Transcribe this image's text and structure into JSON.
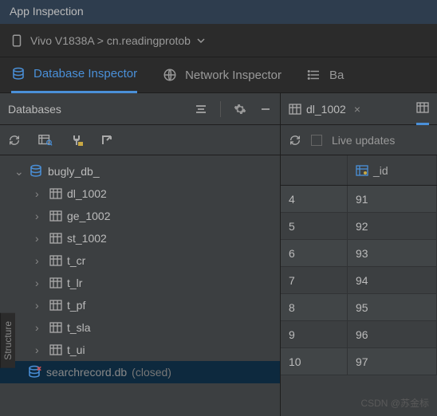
{
  "title": "App Inspection",
  "breadcrumb": "Vivo V1838A > cn.readingprotob",
  "tabs": {
    "database": "Database Inspector",
    "network": "Network Inspector",
    "background": "Ba"
  },
  "left_panel": {
    "title": "Databases"
  },
  "tree": {
    "root": "bugly_db_",
    "children": [
      "dl_1002",
      "ge_1002",
      "st_1002",
      "t_cr",
      "t_lr",
      "t_pf",
      "t_sla",
      "t_ui"
    ],
    "closed_db": "searchrecord.db",
    "closed_suffix": "(closed)"
  },
  "right_tab": {
    "name": "dl_1002"
  },
  "right_toolbar": {
    "live_updates": "Live updates"
  },
  "grid": {
    "header_id": "_id",
    "rows": [
      {
        "idx": "4",
        "id": "91"
      },
      {
        "idx": "5",
        "id": "92"
      },
      {
        "idx": "6",
        "id": "93"
      },
      {
        "idx": "7",
        "id": "94"
      },
      {
        "idx": "8",
        "id": "95"
      },
      {
        "idx": "9",
        "id": "96"
      },
      {
        "idx": "10",
        "id": "97"
      }
    ]
  },
  "sidebar_vertical": "Structure",
  "watermark": "CSDN @苏金标"
}
